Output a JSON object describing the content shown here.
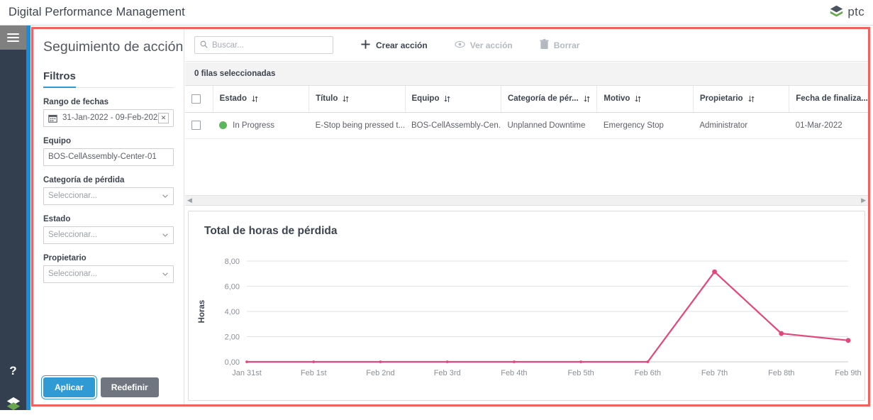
{
  "app": {
    "title": "Digital Performance Management",
    "brand": {
      "name": "ptc",
      "color": "#4a4f57",
      "mark_green": "#6aa84f",
      "mark_dark": "#3f4a56"
    }
  },
  "rail": {
    "menu_icon": "hamburger-icon",
    "help_label": "?",
    "logo_icon": "ptc-diamond-icon"
  },
  "filters": {
    "page_title": "Seguimiento de acción",
    "heading": "Filtros",
    "date_range": {
      "label": "Rango de fechas",
      "value": "31-Jan-2022 - 09-Feb-2022",
      "clear_glyph": "✕",
      "icon": "calendar-icon"
    },
    "equipment": {
      "label": "Equipo",
      "value": "BOS-CellAssembly-Center-01"
    },
    "loss_category": {
      "label": "Categoría de pérdida",
      "placeholder": "Seleccionar..."
    },
    "status": {
      "label": "Estado",
      "placeholder": "Seleccionar..."
    },
    "owner": {
      "label": "Propietario",
      "placeholder": "Seleccionar..."
    },
    "apply_label": "Aplicar",
    "reset_label": "Redefinir",
    "accent": "#2f9ad4"
  },
  "toolbar": {
    "search_placeholder": "Buscar...",
    "create_label": "Crear acción",
    "view_label": "Ver acción",
    "delete_label": "Borrar"
  },
  "grid": {
    "selection_text": "0 filas seleccionadas",
    "columns": [
      "Estado",
      "Título",
      "Equipo",
      "Categoría de pér...",
      "Motivo",
      "Propietario",
      "Fecha de finaliza..."
    ],
    "rows": [
      {
        "status": "In Progress",
        "status_color": "#5bb75b",
        "title": "E-Stop being pressed t...",
        "equipment": "BOS-CellAssembly-Cen...",
        "loss_category": "Unplanned Downtime",
        "reason": "Emergency Stop",
        "owner": "Administrator",
        "due_date": "01-Mar-2022"
      }
    ]
  },
  "chart_data": {
    "type": "line",
    "title": "Total de horas de pérdida",
    "xlabel": "",
    "ylabel": "Horas",
    "categories": [
      "Jan 31st",
      "Feb 1st",
      "Feb 2nd",
      "Feb 3rd",
      "Feb 4th",
      "Feb 5th",
      "Feb 6th",
      "Feb 7th",
      "Feb 8th",
      "Feb 9th"
    ],
    "values": [
      0.0,
      0.0,
      0.0,
      0.0,
      0.0,
      0.0,
      0.0,
      7.15,
      2.25,
      1.7
    ],
    "ylim": [
      0,
      8
    ],
    "yticks": [
      0,
      2,
      4,
      6,
      8
    ],
    "ytick_labels": [
      "0,00",
      "2,00",
      "4,00",
      "6,00",
      "8,00"
    ],
    "series_color": "#e4467c",
    "grid": true,
    "legend": "none"
  }
}
